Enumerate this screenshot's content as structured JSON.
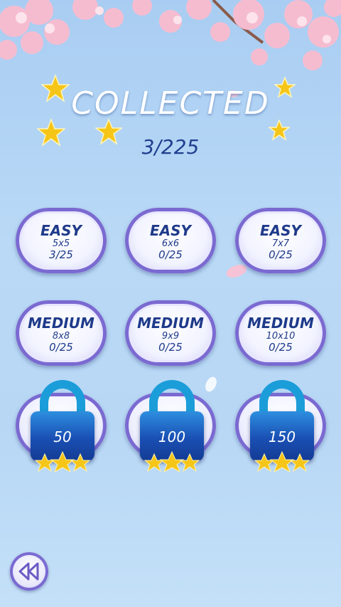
{
  "header": {
    "title": "COLLECTED",
    "stars_count": "3/225"
  },
  "levels": [
    {
      "name": "EASY",
      "size": "5x5",
      "progress": "3/25"
    },
    {
      "name": "EASY",
      "size": "6x6",
      "progress": "0/25"
    },
    {
      "name": "EASY",
      "size": "7x7",
      "progress": "0/25"
    },
    {
      "name": "MEDIUM",
      "size": "8x8",
      "progress": "0/25"
    },
    {
      "name": "MEDIUM",
      "size": "9x9",
      "progress": "0/25"
    },
    {
      "name": "MEDIUM",
      "size": "10x10",
      "progress": "0/25"
    }
  ],
  "locked_levels": [
    {
      "required_stars": "50"
    },
    {
      "required_stars": "100"
    },
    {
      "required_stars": "150"
    }
  ],
  "colors": {
    "accent": "#7a6ad1",
    "text_dark": "#1e3a8a",
    "lock_blue": "#1a4fb3",
    "star_gold": "#f5c518"
  },
  "icons": {
    "back": "back-arrow-icon",
    "lock": "padlock-icon",
    "star": "star-icon"
  }
}
